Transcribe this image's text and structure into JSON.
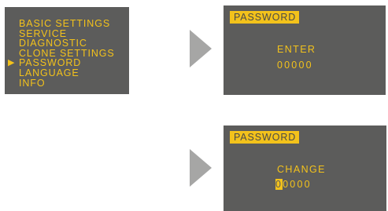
{
  "menu": {
    "items": [
      {
        "label": "BASIC SETTINGS",
        "selected": false
      },
      {
        "label": "SERVICE",
        "selected": false
      },
      {
        "label": "DIAGNOSTIC",
        "selected": false
      },
      {
        "label": "CLONE SETTINGS",
        "selected": false
      },
      {
        "label": "PASSWORD",
        "selected": true
      },
      {
        "label": "LANGUAGE",
        "selected": false
      },
      {
        "label": "INFO",
        "selected": false
      }
    ]
  },
  "enter_screen": {
    "title": "PASSWORD",
    "prompt": "ENTER",
    "code": "00000"
  },
  "change_screen": {
    "title": "PASSWORD",
    "prompt": "CHANGE",
    "active_digit": "0",
    "code_rest": "0000"
  },
  "colors": {
    "screen_bg": "#5c5c5b",
    "text": "#f3c21b",
    "arrow": "#a6a6a5"
  },
  "icons": {
    "menu_cursor": "play-triangle-icon",
    "flow": "arrow-right-icon"
  }
}
